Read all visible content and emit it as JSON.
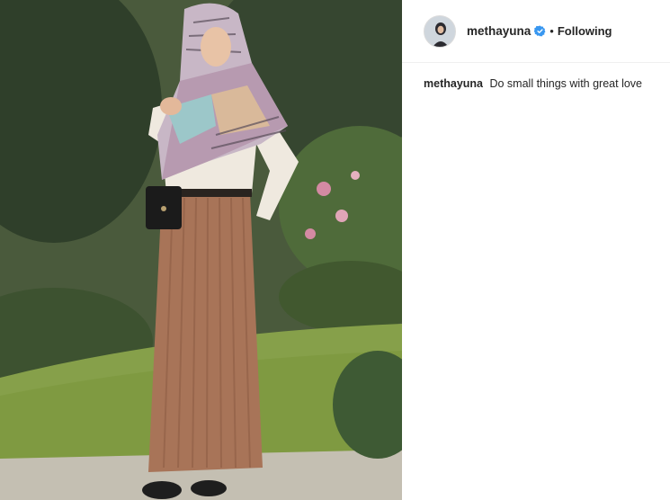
{
  "post": {
    "photo_alt": "Woman in hijab and pleated skirt standing in garden"
  },
  "header": {
    "username": "methayuna",
    "separator": "•",
    "follow_status": "Following",
    "verified_color": "#3897f0"
  },
  "caption": {
    "username": "methayuna",
    "text": "Do small things with great love"
  },
  "colors": {
    "border": "#efefef",
    "text": "#262626"
  }
}
